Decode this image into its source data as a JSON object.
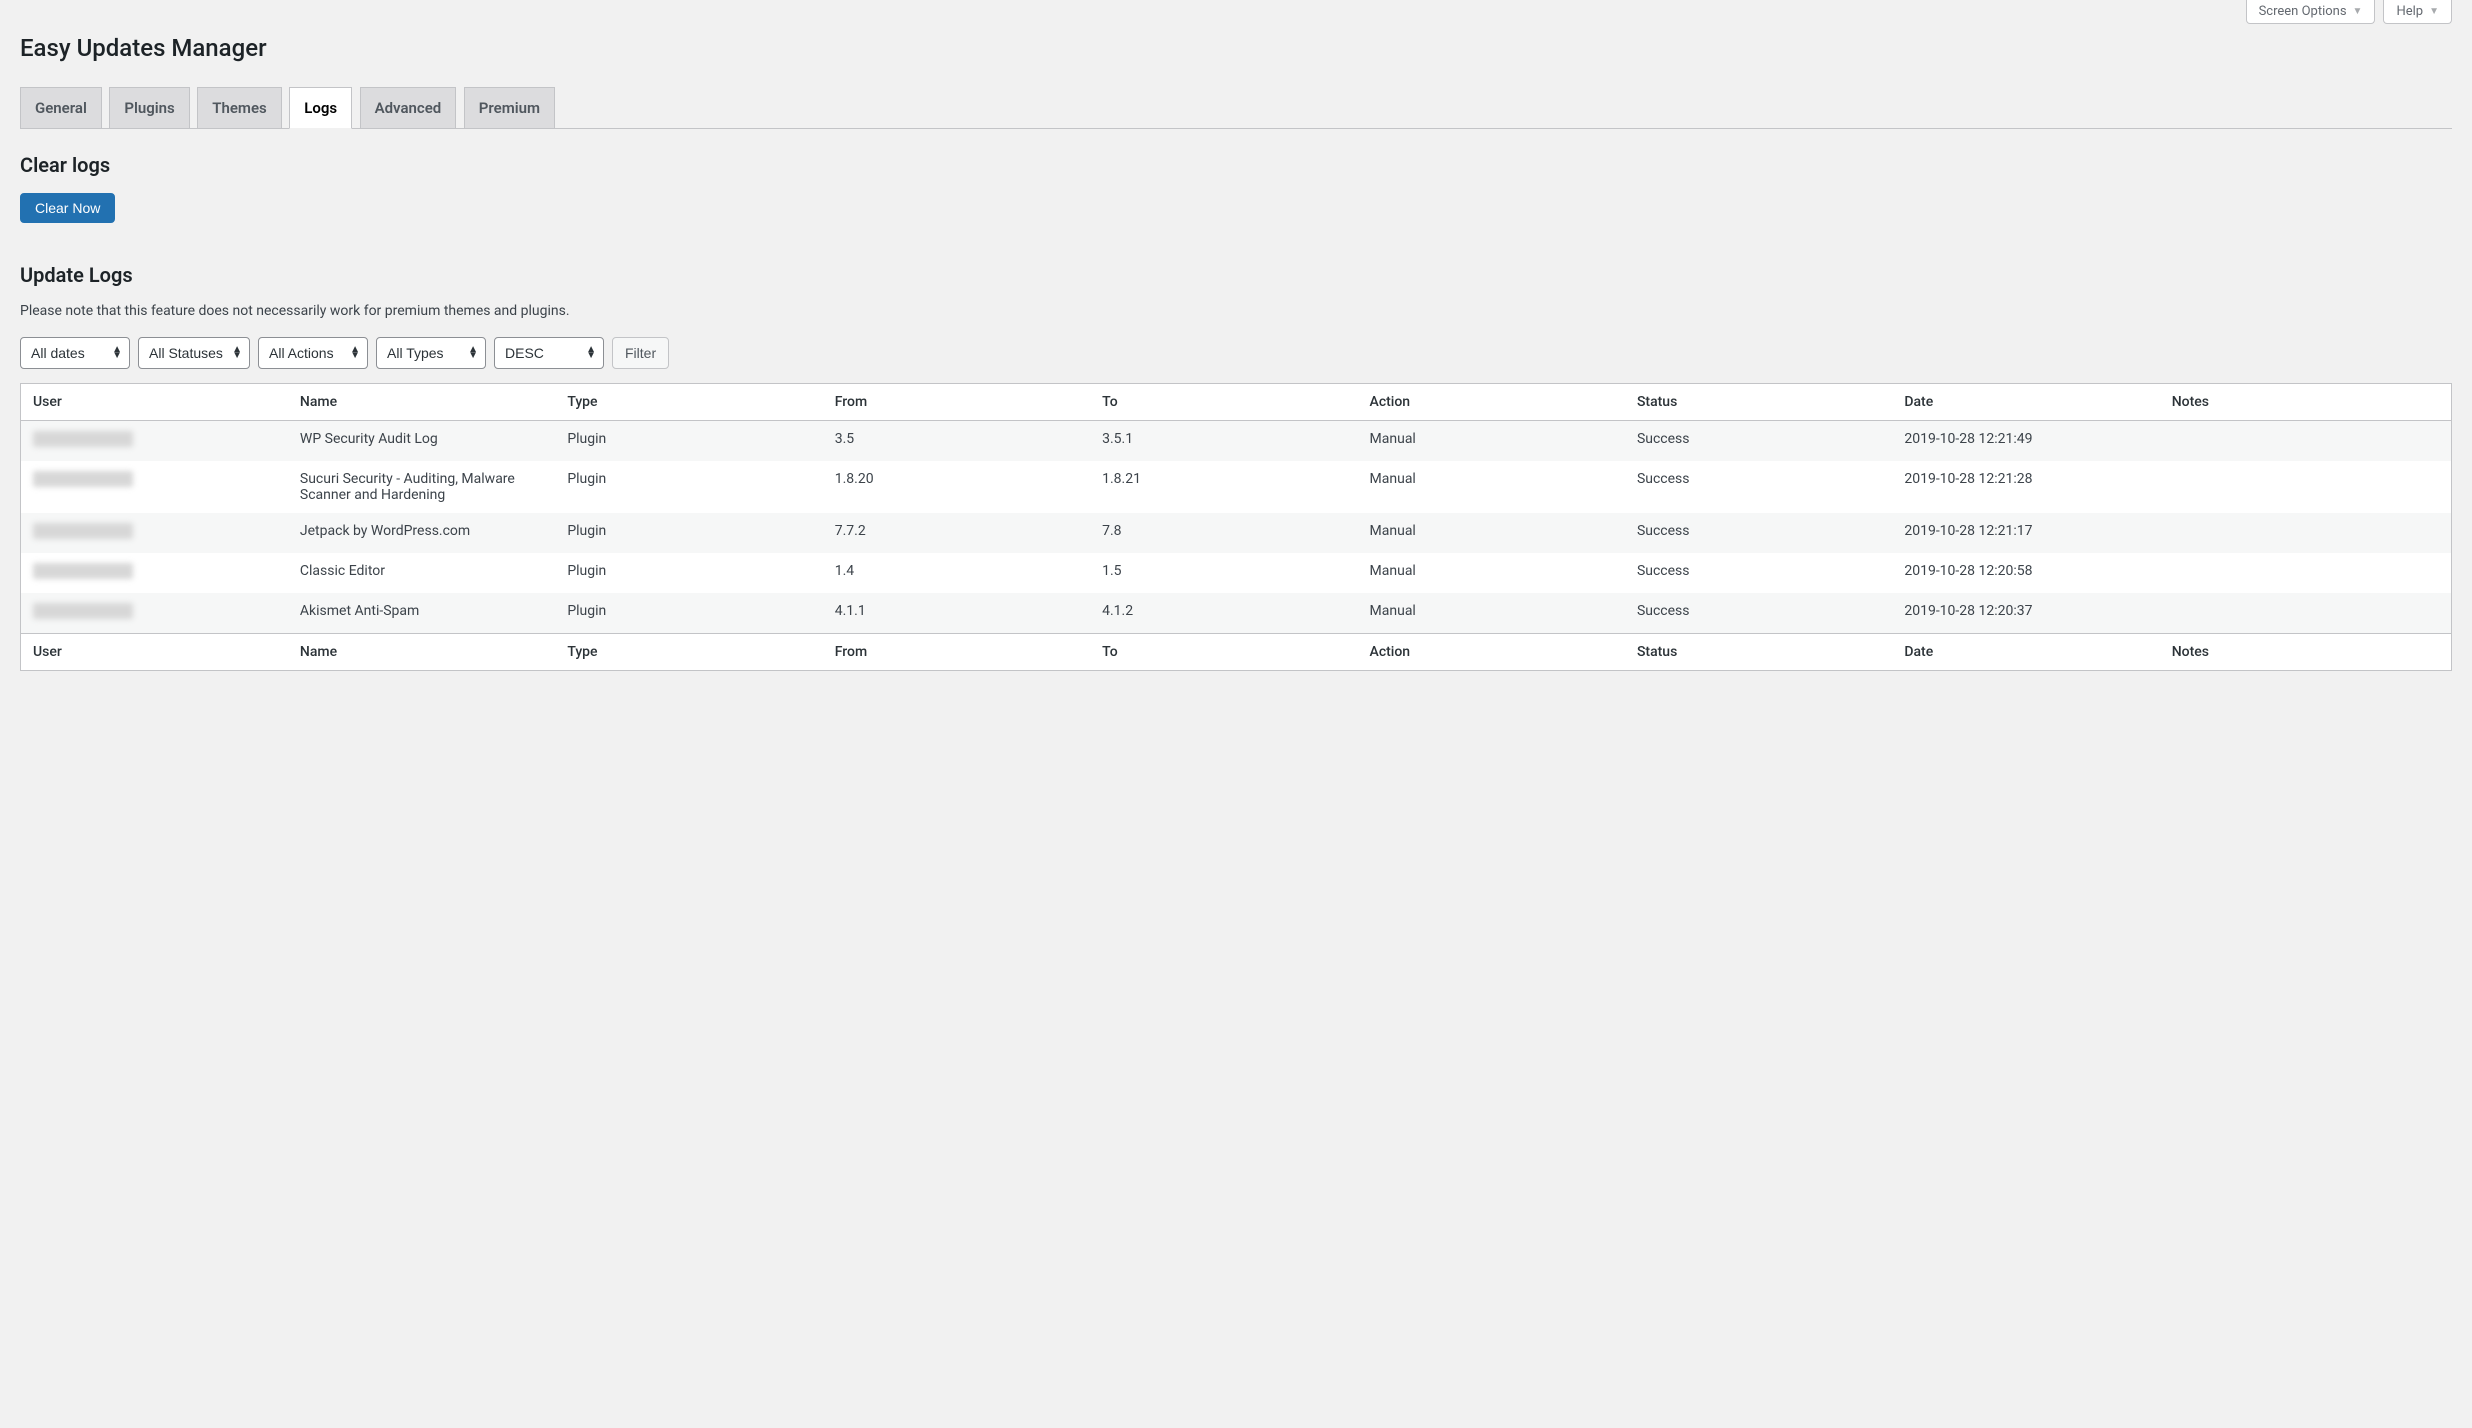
{
  "topbar": {
    "screen_options": "Screen Options",
    "help": "Help"
  },
  "page_title": "Easy Updates Manager",
  "tabs": [
    "General",
    "Plugins",
    "Themes",
    "Logs",
    "Advanced",
    "Premium"
  ],
  "active_tab_index": 3,
  "clear_logs": {
    "heading": "Clear logs",
    "button": "Clear Now"
  },
  "update_logs": {
    "heading": "Update Logs",
    "note": "Please note that this feature does not necessarily work for premium themes and plugins."
  },
  "filters": {
    "dates": "All dates",
    "statuses": "All Statuses",
    "actions": "All Actions",
    "types": "All Types",
    "order": "DESC",
    "filter_button": "Filter"
  },
  "columns": [
    "User",
    "Name",
    "Type",
    "From",
    "To",
    "Action",
    "Status",
    "Date",
    "Notes"
  ],
  "rows": [
    {
      "name": "WP Security Audit Log",
      "type": "Plugin",
      "from": "3.5",
      "to": "3.5.1",
      "action": "Manual",
      "status": "Success",
      "date": "2019-10-28 12:21:49",
      "notes": ""
    },
    {
      "name": "Sucuri Security - Auditing, Malware Scanner and Hardening",
      "type": "Plugin",
      "from": "1.8.20",
      "to": "1.8.21",
      "action": "Manual",
      "status": "Success",
      "date": "2019-10-28 12:21:28",
      "notes": ""
    },
    {
      "name": "Jetpack by WordPress.com",
      "type": "Plugin",
      "from": "7.7.2",
      "to": "7.8",
      "action": "Manual",
      "status": "Success",
      "date": "2019-10-28 12:21:17",
      "notes": ""
    },
    {
      "name": "Classic Editor",
      "type": "Plugin",
      "from": "1.4",
      "to": "1.5",
      "action": "Manual",
      "status": "Success",
      "date": "2019-10-28 12:20:58",
      "notes": ""
    },
    {
      "name": "Akismet Anti-Spam",
      "type": "Plugin",
      "from": "4.1.1",
      "to": "4.1.2",
      "action": "Manual",
      "status": "Success",
      "date": "2019-10-28 12:20:37",
      "notes": ""
    }
  ]
}
